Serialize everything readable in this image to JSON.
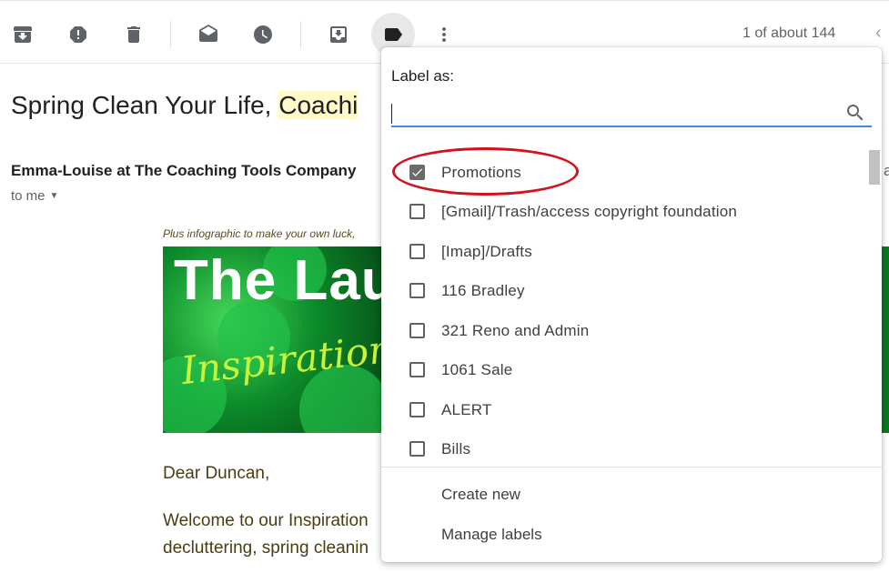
{
  "toolbar": {
    "pagination_text": "1 of about 144",
    "icons": [
      "archive-icon",
      "report-spam-icon",
      "delete-icon",
      "mark-unread-icon",
      "snooze-icon",
      "move-to-icon",
      "label-icon",
      "more-icon",
      "chevron-left-icon"
    ]
  },
  "email": {
    "subject_visible": "Spring Clean Your Life, ",
    "subject_highlight": "Coachi",
    "sender_visible": "Emma-Louise at The Coaching Tools Company",
    "sender_right_fragment": "a",
    "recipient_text": "to me",
    "preheader_visible": "Plus infographic to make your own luck,",
    "banner_title_visible": "The Lau",
    "banner_script_visible": "Inspiration",
    "greeting": "Dear Duncan,",
    "body_line1_visible": "Welcome to our Inspiration",
    "body_line2_visible": "decluttering, spring cleanin"
  },
  "label_menu": {
    "title": "Label as:",
    "search_value": "",
    "labels": [
      {
        "label": "Promotions",
        "checked": true
      },
      {
        "label": "[Gmail]/Trash/access copyright foundation",
        "checked": false
      },
      {
        "label": "[Imap]/Drafts",
        "checked": false
      },
      {
        "label": "116 Bradley",
        "checked": false
      },
      {
        "label": "321 Reno and Admin",
        "checked": false
      },
      {
        "label": "1061 Sale",
        "checked": false
      },
      {
        "label": "ALERT",
        "checked": false
      },
      {
        "label": "Bills",
        "checked": false
      }
    ],
    "actions": {
      "create_new": "Create new",
      "manage_labels": "Manage labels"
    }
  },
  "colors": {
    "accent": "#4285f4",
    "annotation": "#d0131d",
    "highlight": "#fffac8"
  }
}
